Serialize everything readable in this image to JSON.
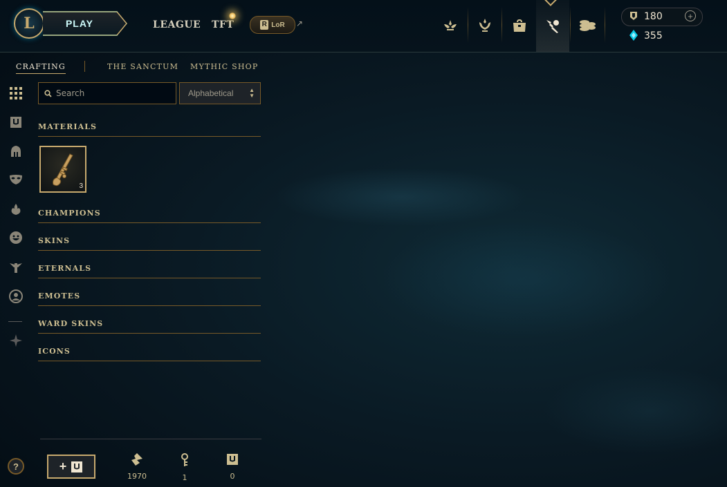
{
  "topbar": {
    "play_label": "PLAY",
    "league_label": "LEAGUE",
    "tft_label": "TFT",
    "lor_label": "LoR",
    "lor_mark": "R",
    "lor_arrow": "↗"
  },
  "currency": {
    "blue_essence": "180",
    "orange_essence": "355",
    "add_symbol": "+"
  },
  "subnav": {
    "crafting": "CRAFTING",
    "sanctum": "THE SANCTUM",
    "mythic_shop": "MYTHIC SHOP"
  },
  "search": {
    "placeholder": "Search"
  },
  "sort": {
    "selected": "Alphabetical"
  },
  "categories": {
    "materials": "MATERIALS",
    "champions": "CHAMPIONS",
    "skins": "SKINS",
    "eternals": "ETERNALS",
    "emotes": "EMOTES",
    "ward_skins": "WARD SKINS",
    "icons": "ICONS"
  },
  "materials_items": [
    {
      "icon": "hextech-key-icon",
      "count": "3"
    }
  ],
  "bottom": {
    "help": "?",
    "add_plus": "+",
    "orange_essence": "1970",
    "keys": "1",
    "chests": "0"
  },
  "colors": {
    "gold": "#c8aa6e",
    "gold_dark": "#785a28",
    "text": "#cdbe91",
    "play_blue": "#0596aa",
    "bg": "#0a1a24"
  }
}
